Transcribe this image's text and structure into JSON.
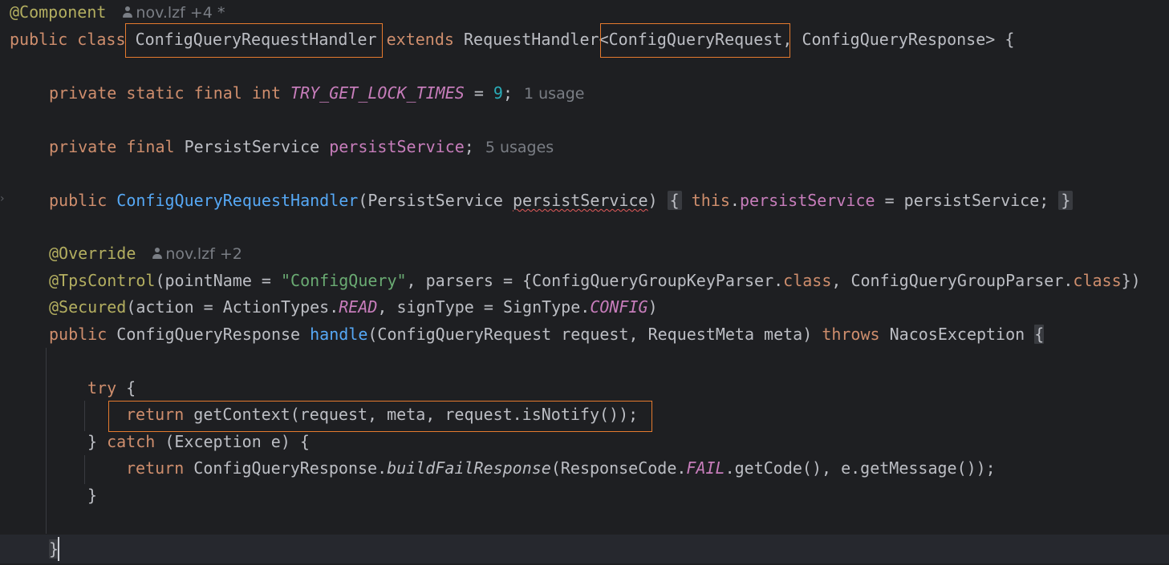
{
  "editor": {
    "line1": {
      "annotation": "@Component",
      "author": "nov.lzf",
      "author_more": "+4 *"
    },
    "line2": {
      "kw1": "public",
      "kw2": "class",
      "classname": "ConfigQueryRequestHandler",
      "kw3": "extends",
      "super": "RequestHandler",
      "lt": "<",
      "generic1": "ConfigQueryRequest",
      "comma": ",",
      "generic2": "ConfigQueryResponse",
      "rest": "> {"
    },
    "line3": {
      "kw": "private static final int",
      "const": "TRY_GET_LOCK_TIMES",
      "eq": " = ",
      "num": "9",
      "semi": ";",
      "usage": "1 usage"
    },
    "line4": {
      "kw": "private final",
      "type": "PersistService",
      "field": "persistService",
      "semi": ";",
      "usage": "5 usages"
    },
    "line5": {
      "kw": "public",
      "ctor": "ConfigQueryRequestHandler",
      "paren_open": "(PersistService ",
      "param": "persistService",
      "paren_close": ")",
      "brace_open": "{",
      "this_kw": "this",
      "dot": ".",
      "field": "persistService",
      "assign": " = persistService;",
      "brace_close": "}"
    },
    "line6": {
      "annotation": "@Override",
      "author": "nov.lzf",
      "author_more": "+2"
    },
    "line7": {
      "annotation": "@TpsControl",
      "part1": "(pointName = ",
      "str": "\"ConfigQuery\"",
      "part2": ", parsers = {ConfigQueryGroupKeyParser.",
      "kw1": "class",
      "part3": ", ConfigQueryGroupParser.",
      "kw2": "class",
      "part4": "})"
    },
    "line8": {
      "annotation": "@Secured",
      "part1": "(action = ActionTypes.",
      "c1": "READ",
      "part2": ", signType = SignType.",
      "c2": "CONFIG",
      "part3": ")"
    },
    "line9": {
      "kw": "public",
      "type": "ConfigQueryResponse",
      "method": "handle",
      "params": "(ConfigQueryRequest request, RequestMeta meta)",
      "throws_kw": "throws",
      "exc": "NacosException",
      "brace": "{"
    },
    "line10": {
      "kw": "try",
      "rest": " {"
    },
    "line11": {
      "kw": "return",
      "rest": " getContext(request, meta, request.isNotify());"
    },
    "line12": {
      "brace": "} ",
      "kw": "catch",
      "rest": " (Exception e) {"
    },
    "line13": {
      "kw": "return",
      "part1": " ConfigQueryResponse.",
      "method": "buildFailResponse",
      "part2": "(ResponseCode.",
      "c1": "FAIL",
      "part3": ".getCode(), e.getMessage());"
    },
    "line14": {
      "brace": "}"
    },
    "line15": {
      "brace": "}"
    }
  },
  "icons": {
    "author": "person-icon",
    "gutter": "chevron-right-icon"
  },
  "colors": {
    "background": "#1e1f22",
    "keyword": "#cf8e6d",
    "annotation": "#b3ae60",
    "field": "#c77dbb",
    "number": "#2aacb8",
    "string": "#6aab73",
    "function": "#56a8f5",
    "highlight_box": "#e57a2e"
  }
}
